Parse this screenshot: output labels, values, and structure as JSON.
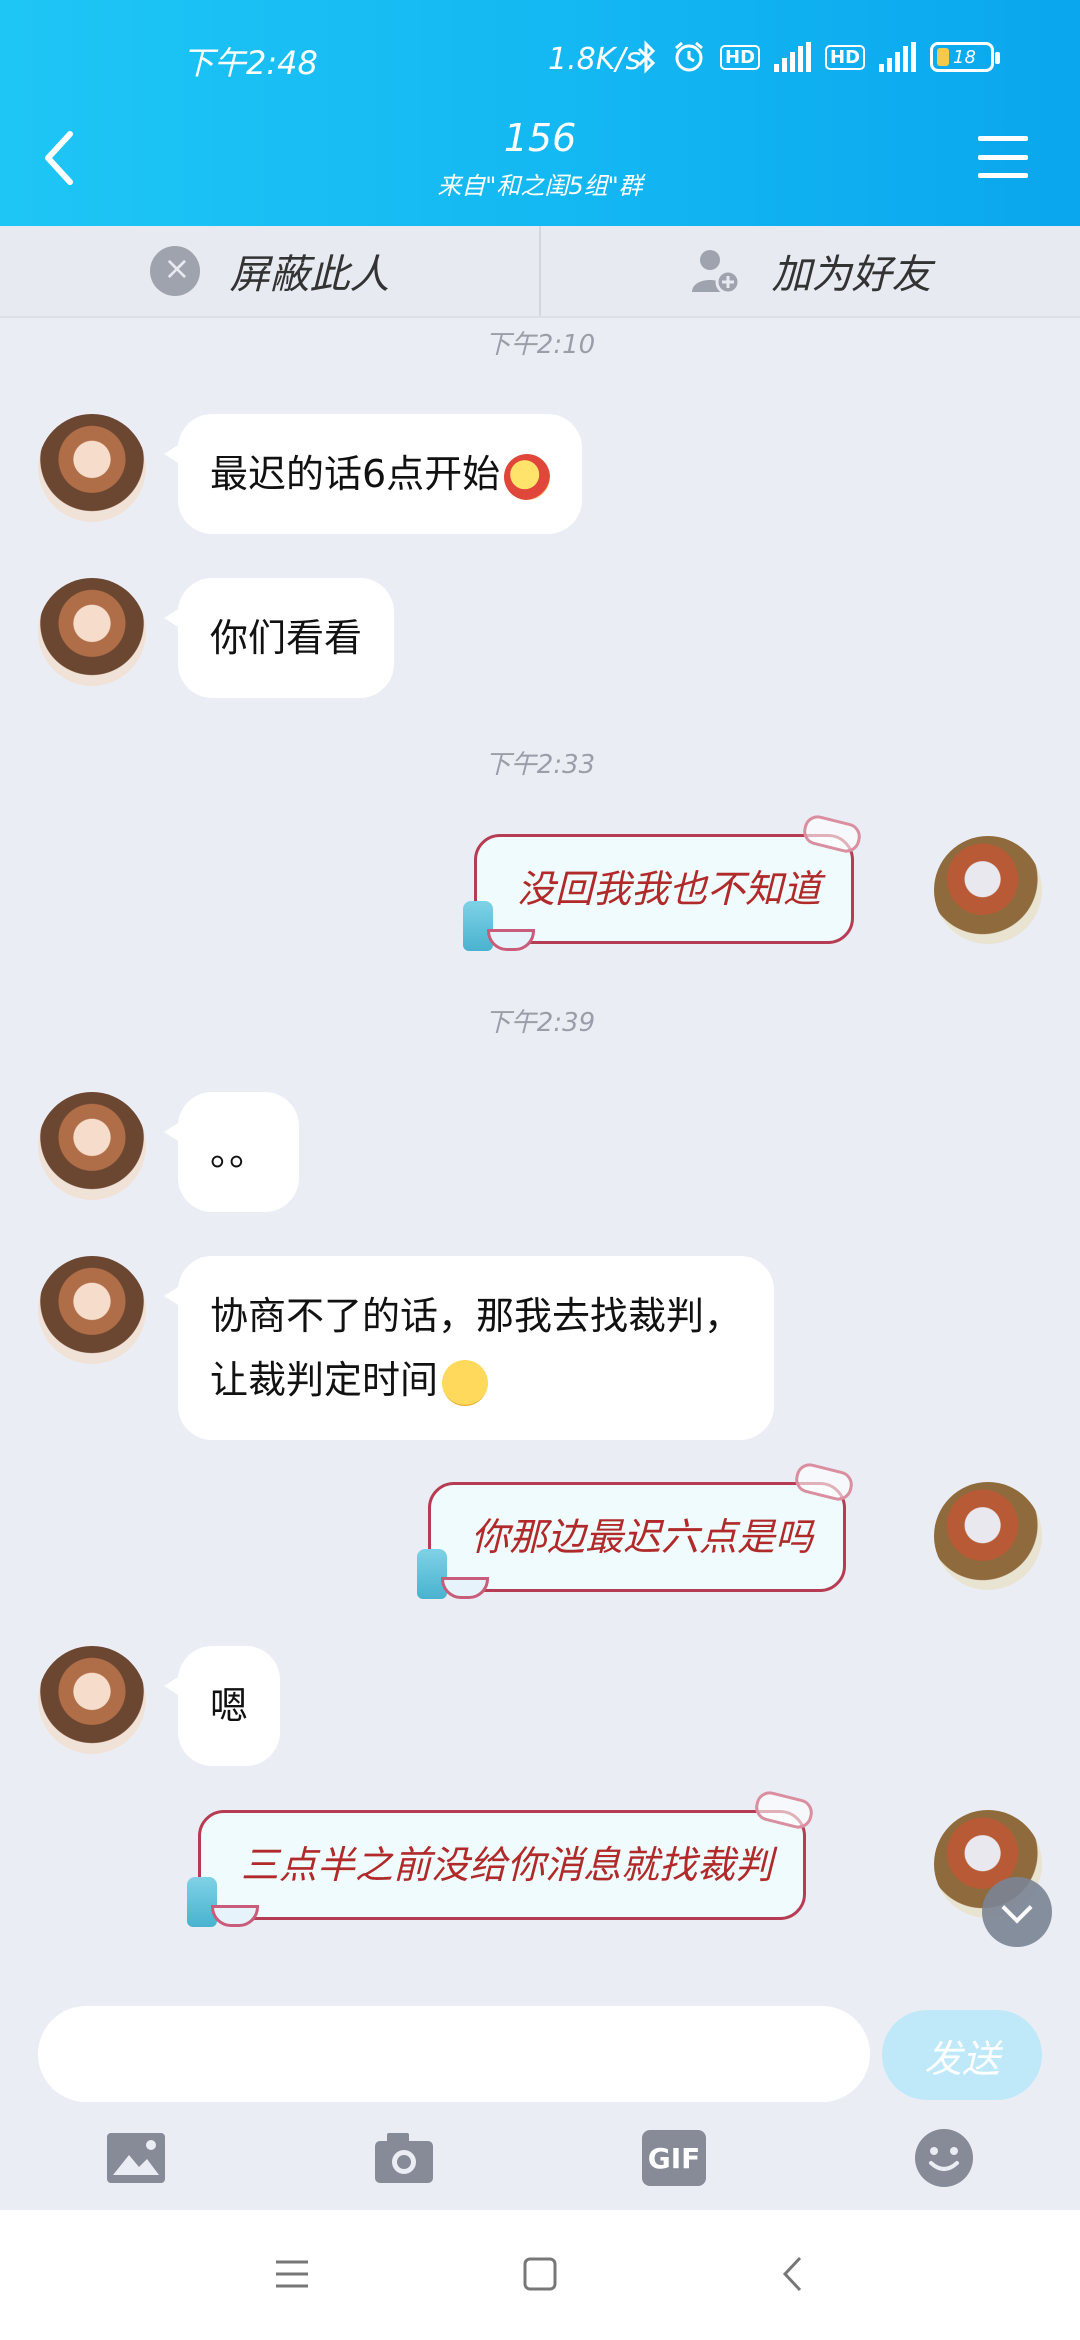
{
  "status_bar": {
    "time": "下午2:48",
    "net_speed": "1.8K/s",
    "hd_label": "HD",
    "network": "4G",
    "battery": "18"
  },
  "header": {
    "title": "156",
    "subtitle": "来自\"和之闺5组\"群"
  },
  "action_bar": {
    "block_label": "屏蔽此人",
    "add_friend_label": "加为好友"
  },
  "messages": [
    {
      "type": "time",
      "text": "下午2:10"
    },
    {
      "side": "left",
      "text": "最迟的话6点开始",
      "emoji": "fish-emoji"
    },
    {
      "side": "left",
      "text": "你们看看"
    },
    {
      "type": "time",
      "text": "下午2:33"
    },
    {
      "side": "right",
      "text": "没回我我也不知道"
    },
    {
      "type": "time",
      "text": "下午2:39"
    },
    {
      "side": "left",
      "text": "。。"
    },
    {
      "side": "left",
      "text": "协商不了的话，那我去找裁判，",
      "text2": "让裁判定时间",
      "emoji": "face-emoji"
    },
    {
      "side": "right",
      "text": "你那边最迟六点是吗"
    },
    {
      "side": "left",
      "text": "嗯"
    },
    {
      "side": "right",
      "text": "三点半之前没给你消息就找裁判"
    }
  ],
  "input": {
    "value": "",
    "send_label": "发送"
  },
  "tools": {
    "gif_label": "GIF"
  },
  "colors": {
    "header_start": "#1ec6f5",
    "header_end": "#0aa6ee",
    "send_disabled": "#bfe9f9",
    "right_bubble_text": "#b02a2a"
  }
}
